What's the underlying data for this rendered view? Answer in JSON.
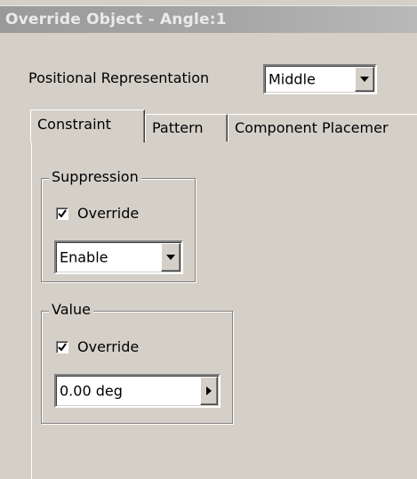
{
  "window": {
    "title": "Override Object - Angle:1"
  },
  "positional": {
    "label": "Positional Representation",
    "value": "Middle"
  },
  "tabs": [
    {
      "label": "Constraint",
      "active": true
    },
    {
      "label": "Pattern",
      "active": false
    },
    {
      "label": "Component Placemer",
      "active": false
    }
  ],
  "suppression": {
    "legend": "Suppression",
    "override_label": "Override",
    "override_checked": true,
    "value": "Enable"
  },
  "value_group": {
    "legend": "Value",
    "override_label": "Override",
    "override_checked": true,
    "value": "0.00 deg"
  }
}
